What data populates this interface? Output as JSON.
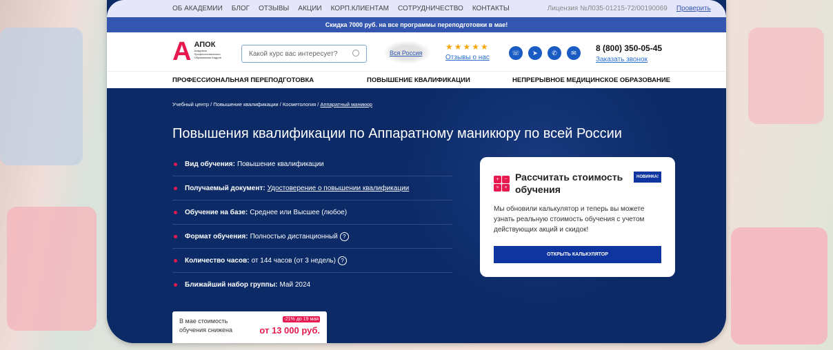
{
  "topnav": {
    "items": [
      "ОБ АКАДЕМИИ",
      "БЛОГ",
      "ОТЗЫВЫ",
      "АКЦИИ",
      "КОРП.КЛИЕНТАМ",
      "СОТРУДНИЧЕСТВО",
      "КОНТАКТЫ"
    ],
    "license": "Лицензия №Л035-01215-72/00190069",
    "verify": "Проверить"
  },
  "banner": "Скидка 7000 руб. на все программы переподготовки в мае!",
  "header": {
    "logo_title": "АПОК",
    "logo_letter": "А",
    "logo_sub": "Академия Профессионального Образования Кадров",
    "search_placeholder": "Какой курс вас интересует?",
    "region": "Вся Россия",
    "stars": "★★★★★",
    "reviews": "Отзывы о нас",
    "phone": "8 (800) 350-05-45",
    "callback": "Заказать звонок"
  },
  "menu": [
    "ПРОФЕССИОНАЛЬНАЯ ПЕРЕПОДГОТОВКА",
    "ПОВЫШЕНИЕ КВАЛИФИКАЦИИ",
    "НЕПРЕРЫВНОЕ МЕДИЦИНСКОЕ ОБРАЗОВАНИЕ"
  ],
  "breadcrumbs": [
    "Учебный центр",
    "Повышение квалификации",
    "Косметология",
    "Аппаратный маникюр"
  ],
  "title": "Повышения квалификации по Аппаратному маникюру по всей России",
  "facts": [
    {
      "label": "Вид обучения:",
      "value": "Повышение квалификации"
    },
    {
      "label": "Получаемый документ:",
      "value": "Удостоверение о повышении квалификации"
    },
    {
      "label": "Обучение на базе:",
      "value": "Среднее или Высшее (любое)"
    },
    {
      "label": "Формат обучения:",
      "value": "Полностью дистанционный"
    },
    {
      "label": "Количество часов:",
      "value": "от 144 часов (от 3 недель)"
    },
    {
      "label": "Ближайший набор группы:",
      "value": "Май 2024"
    }
  ],
  "card": {
    "title": "Рассчитать стоимость обучения",
    "badge": "НОВИНКА!",
    "text": "Мы обновили калькулятор и теперь вы можете узнать реальную стоимость обучения с учетом действующих акций и скидок!",
    "button": "ОТКРЫТЬ КАЛЬКУЛЯТОР"
  },
  "price": {
    "text": "В мае стоимость обучения снижена",
    "badge": "-21% до 19 мая",
    "value": "от 13 000 руб."
  }
}
